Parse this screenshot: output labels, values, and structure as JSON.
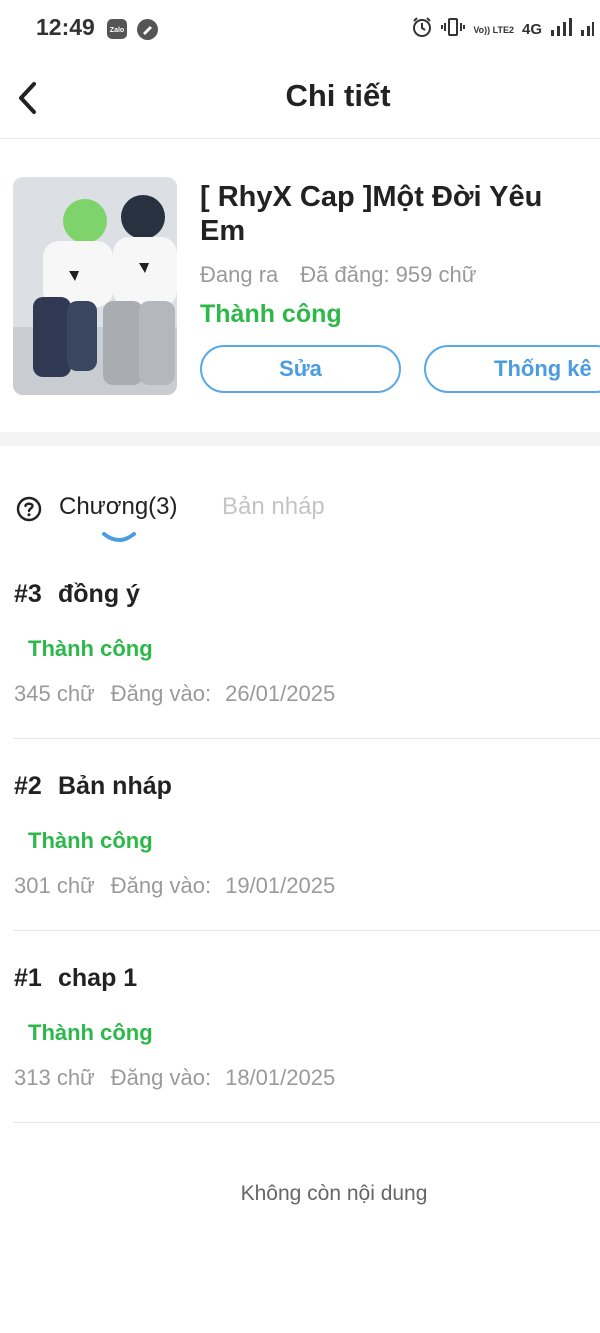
{
  "status_bar": {
    "time": "12:49",
    "network": "4G",
    "volte": "Vo)) LTE2",
    "icons": [
      "zalo-icon",
      "message-icon",
      "alarm-icon",
      "vibrate-icon",
      "signal-icon"
    ]
  },
  "header": {
    "title": "Chi tiết",
    "back_icon": "chevron-left-icon"
  },
  "story": {
    "title": "[ RhyX Cap ]Một Đời Yêu Em",
    "status_label": "Đang ra",
    "posted_label": "Đã đăng: 959 chữ",
    "publish_state": "Thành công",
    "edit_label": "Sửa",
    "stats_label": "Thống kê"
  },
  "tabs": {
    "chapters_label": "Chương(3)",
    "drafts_label": "Bản nháp"
  },
  "chapters": [
    {
      "number": "#3",
      "title": "đồng ý",
      "status": "Thành công",
      "words": "345 chữ",
      "posted_prefix": "Đăng vào:",
      "date": "26/01/2025"
    },
    {
      "number": "#2",
      "title": "Bản nháp",
      "status": "Thành công",
      "words": "301 chữ",
      "posted_prefix": "Đăng vào:",
      "date": "19/01/2025"
    },
    {
      "number": "#1",
      "title": "chap 1",
      "status": "Thành công",
      "words": "313 chữ",
      "posted_prefix": "Đăng vào:",
      "date": "18/01/2025"
    }
  ],
  "footer": {
    "end_text": "Không còn nội dung"
  },
  "colors": {
    "accent": "#4a9de0",
    "success": "#2db84a",
    "muted": "#9a9a9a"
  }
}
